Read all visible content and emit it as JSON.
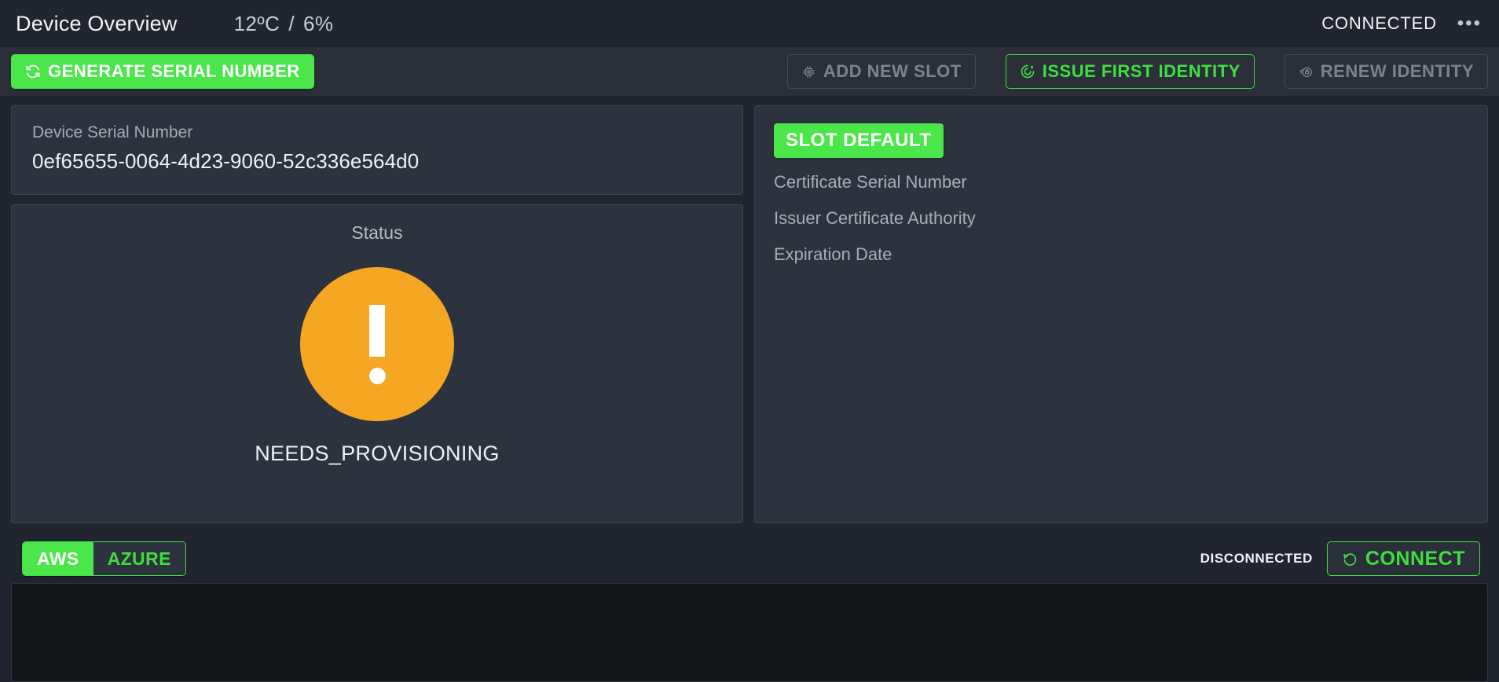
{
  "header": {
    "title": "Device Overview",
    "temperature": "12ºC",
    "separator": "/",
    "humidity": "6%",
    "connection_status": "CONNECTED",
    "more_menu": "•••"
  },
  "toolbar": {
    "generate_serial_label": "GENERATE SERIAL NUMBER",
    "add_slot_label": "ADD NEW SLOT",
    "issue_identity_label": "ISSUE FIRST IDENTITY",
    "renew_identity_label": "RENEW IDENTITY"
  },
  "device": {
    "serial_label": "Device Serial Number",
    "serial_value": "0ef65655-0064-4d23-9060-52c336e564d0"
  },
  "status": {
    "caption": "Status",
    "value": "NEEDS_PROVISIONING"
  },
  "slot": {
    "badge": "SLOT DEFAULT",
    "rows": [
      "Certificate Serial Number",
      "Issuer Certificate Authority",
      "Expiration Date"
    ]
  },
  "cloud": {
    "tabs": [
      {
        "label": "AWS",
        "active": true
      },
      {
        "label": "AZURE",
        "active": false
      }
    ],
    "connection_state": "DISCONNECTED",
    "connect_label": "CONNECT"
  },
  "colors": {
    "accent_green": "#4ae64a",
    "outline_green": "#3ee03e",
    "warning_orange": "#f5a623",
    "panel_bg": "#2d333e",
    "app_bg": "#20252f",
    "toolbar_bg": "#2a2f39",
    "console_bg": "#141619",
    "disabled_text": "#7d838d"
  }
}
